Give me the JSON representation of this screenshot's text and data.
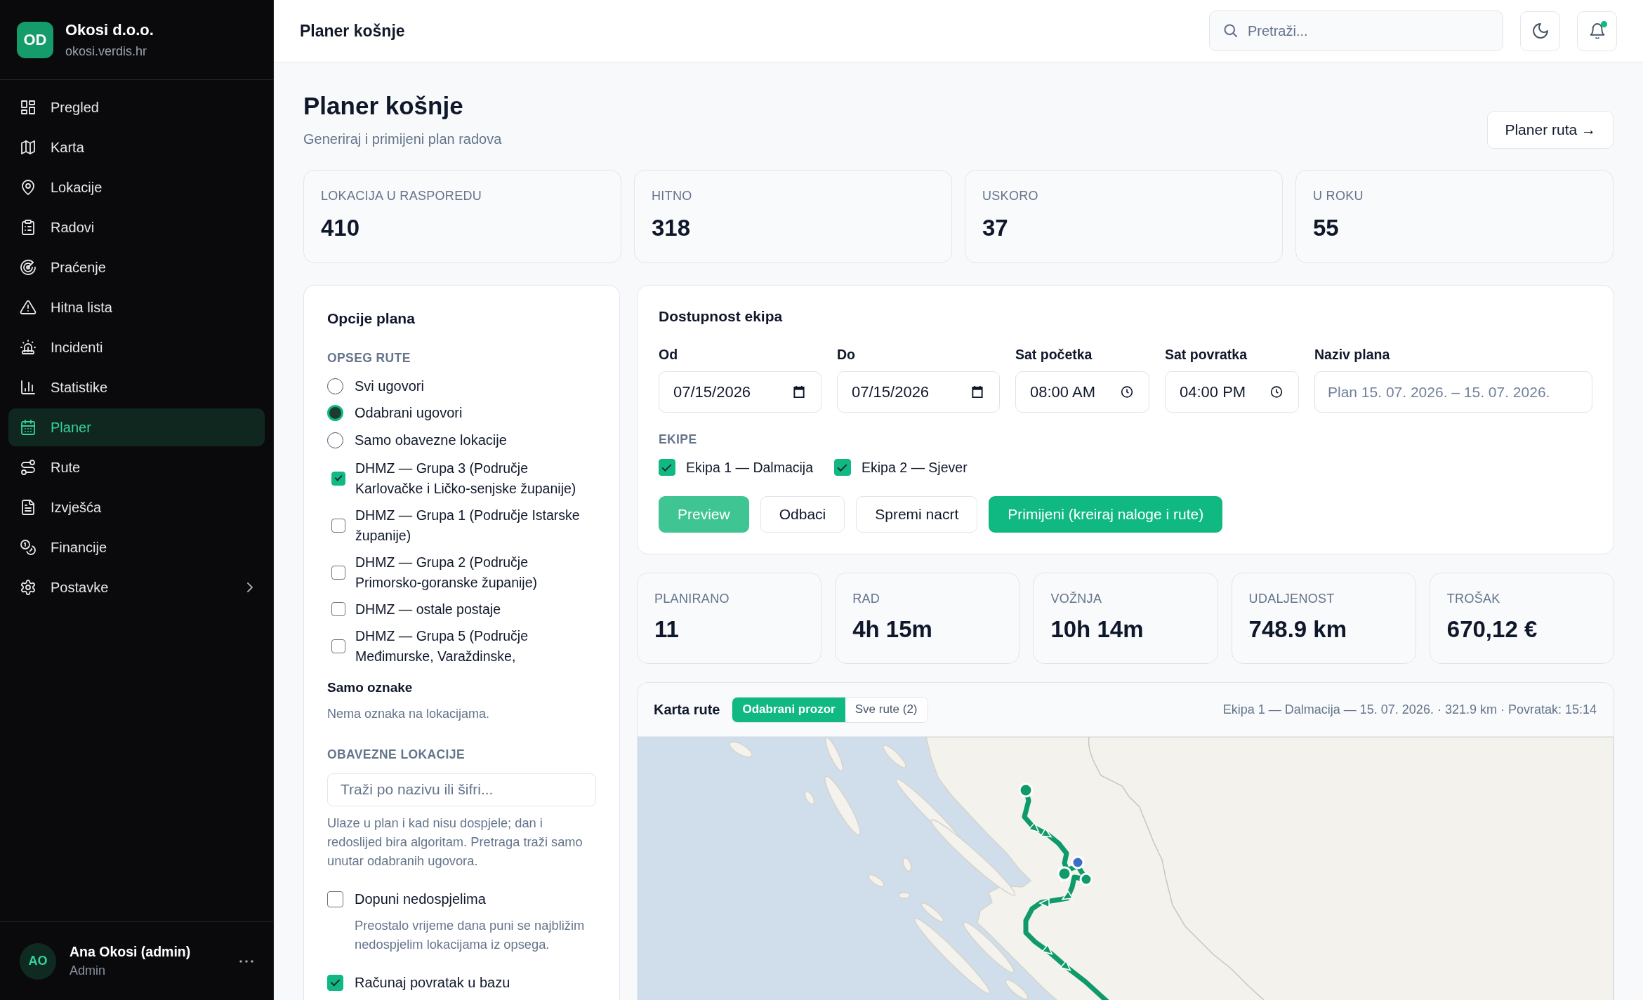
{
  "sidebar": {
    "brand": {
      "logo": "OD",
      "name": "Okosi d.o.o.",
      "domain": "okosi.verdis.hr"
    },
    "items": [
      {
        "label": "Pregled",
        "kind": "link",
        "selected": false
      },
      {
        "label": "Karta",
        "kind": "link",
        "selected": false
      },
      {
        "label": "Lokacije",
        "kind": "link",
        "selected": false
      },
      {
        "label": "Radovi",
        "kind": "link",
        "selected": false
      },
      {
        "label": "Praćenje",
        "kind": "link",
        "selected": false
      },
      {
        "label": "Hitna lista",
        "kind": "link",
        "selected": false
      },
      {
        "label": "Incidenti",
        "kind": "link",
        "selected": false
      },
      {
        "label": "Statistike",
        "kind": "link",
        "selected": false
      },
      {
        "label": "Planer",
        "kind": "link",
        "selected": true
      },
      {
        "label": "Rute",
        "kind": "link",
        "selected": false
      },
      {
        "label": "Izvješća",
        "kind": "link",
        "selected": false
      },
      {
        "label": "Financije",
        "kind": "link",
        "selected": false
      },
      {
        "label": "Postavke",
        "kind": "group",
        "selected": false
      }
    ],
    "user": {
      "initials": "AO",
      "name": "Ana Okosi (admin)",
      "role": "Admin"
    }
  },
  "topbar": {
    "title": "Planer košnje",
    "search": {
      "placeholder": "Pretraži..."
    },
    "notifications": {
      "unread": true
    }
  },
  "page": {
    "title": "Planer košnje",
    "subtitle": "Generiraj i primijeni plan radova",
    "route_planner_button": "Planer ruta →"
  },
  "stats": [
    {
      "label": "LOKACIJA U RASPOREDU",
      "value": "410"
    },
    {
      "label": "HITNO",
      "value": "318"
    },
    {
      "label": "USKORO",
      "value": "37"
    },
    {
      "label": "U ROKU",
      "value": "55"
    }
  ],
  "plan_options": {
    "title": "Opcije plana",
    "scope": {
      "label": "OPSEG RUTE",
      "options": [
        {
          "label": "Svi ugovori",
          "selected": false
        },
        {
          "label": "Odabrani ugovori",
          "selected": true
        },
        {
          "label": "Samo obavezne lokacije",
          "selected": false
        }
      ]
    },
    "contracts": [
      {
        "label": "DHMZ — Grupa 3 (Područje Karlovačke i Ličko-senjske županije)",
        "checked": true
      },
      {
        "label": "DHMZ — Grupa 1 (Područje Istarske županije)",
        "checked": false
      },
      {
        "label": "DHMZ — Grupa 2 (Područje Primorsko-goranske županije)",
        "checked": false
      },
      {
        "label": "DHMZ — ostale postaje",
        "checked": false
      },
      {
        "label": "DHMZ — Grupa 5 (Područje Međimurske, Varaždinske,",
        "checked": false
      }
    ],
    "tags": {
      "title": "Samo oznake",
      "empty_text": "Nema oznaka na lokacijama."
    },
    "required": {
      "label": "OBAVEZNE LOKACIJE",
      "search": {
        "placeholder": "Traži po nazivu ili šifri..."
      },
      "help": "Ulaze u plan i kad nisu dospjele; dan i redoslijed bira algoritam. Pretraga traži samo unutar odabranih ugovora."
    },
    "toggles": [
      {
        "label": "Dopuni nedospjelima",
        "checked": false,
        "help": "Preostalo vrijeme dana puni se najbližim nedospjelim lokacijama iz opsega."
      },
      {
        "label": "Računaj povratak u bazu",
        "checked": true
      }
    ]
  },
  "availability": {
    "title": "Dostupnost ekipa",
    "fields": [
      {
        "label": "Od",
        "kind": "date",
        "value": "07/15/2026"
      },
      {
        "label": "Do",
        "kind": "date",
        "value": "07/15/2026"
      },
      {
        "label": "Sat početka",
        "kind": "time",
        "value": "08:00 AM"
      },
      {
        "label": "Sat povratka",
        "kind": "time",
        "value": "04:00 PM"
      },
      {
        "label": "Naziv plana",
        "kind": "text",
        "placeholder": "Plan 15. 07. 2026. – 15. 07. 2026."
      }
    ],
    "crews": {
      "label": "EKIPE",
      "items": [
        {
          "label": "Ekipa 1 — Dalmacija",
          "checked": true
        },
        {
          "label": "Ekipa 2 — Sjever",
          "checked": true
        }
      ]
    },
    "actions": [
      {
        "label": "Preview",
        "kind": "accent"
      },
      {
        "label": "Odbaci",
        "kind": "outline"
      },
      {
        "label": "Spremi nacrt",
        "kind": "outline"
      },
      {
        "label": "Primijeni (kreiraj naloge i rute)",
        "kind": "primary"
      }
    ]
  },
  "metrics": [
    {
      "label": "PLANIRANO",
      "value": "11"
    },
    {
      "label": "RAD",
      "value": "4h 15m"
    },
    {
      "label": "VOŽNJA",
      "value": "10h 14m"
    },
    {
      "label": "UDALJENOST",
      "value": "748.9 km"
    },
    {
      "label": "TROŠAK",
      "value": "670,12 €"
    }
  ],
  "route_map": {
    "title": "Karta rute",
    "views": [
      {
        "label": "Odabrani prozor",
        "selected": true
      },
      {
        "label": "Sve rute (2)",
        "selected": false
      }
    ],
    "summary": "Ekipa 1 — Dalmacija — 15. 07. 2026. · 321.9 km · Povratak: 15:14"
  }
}
